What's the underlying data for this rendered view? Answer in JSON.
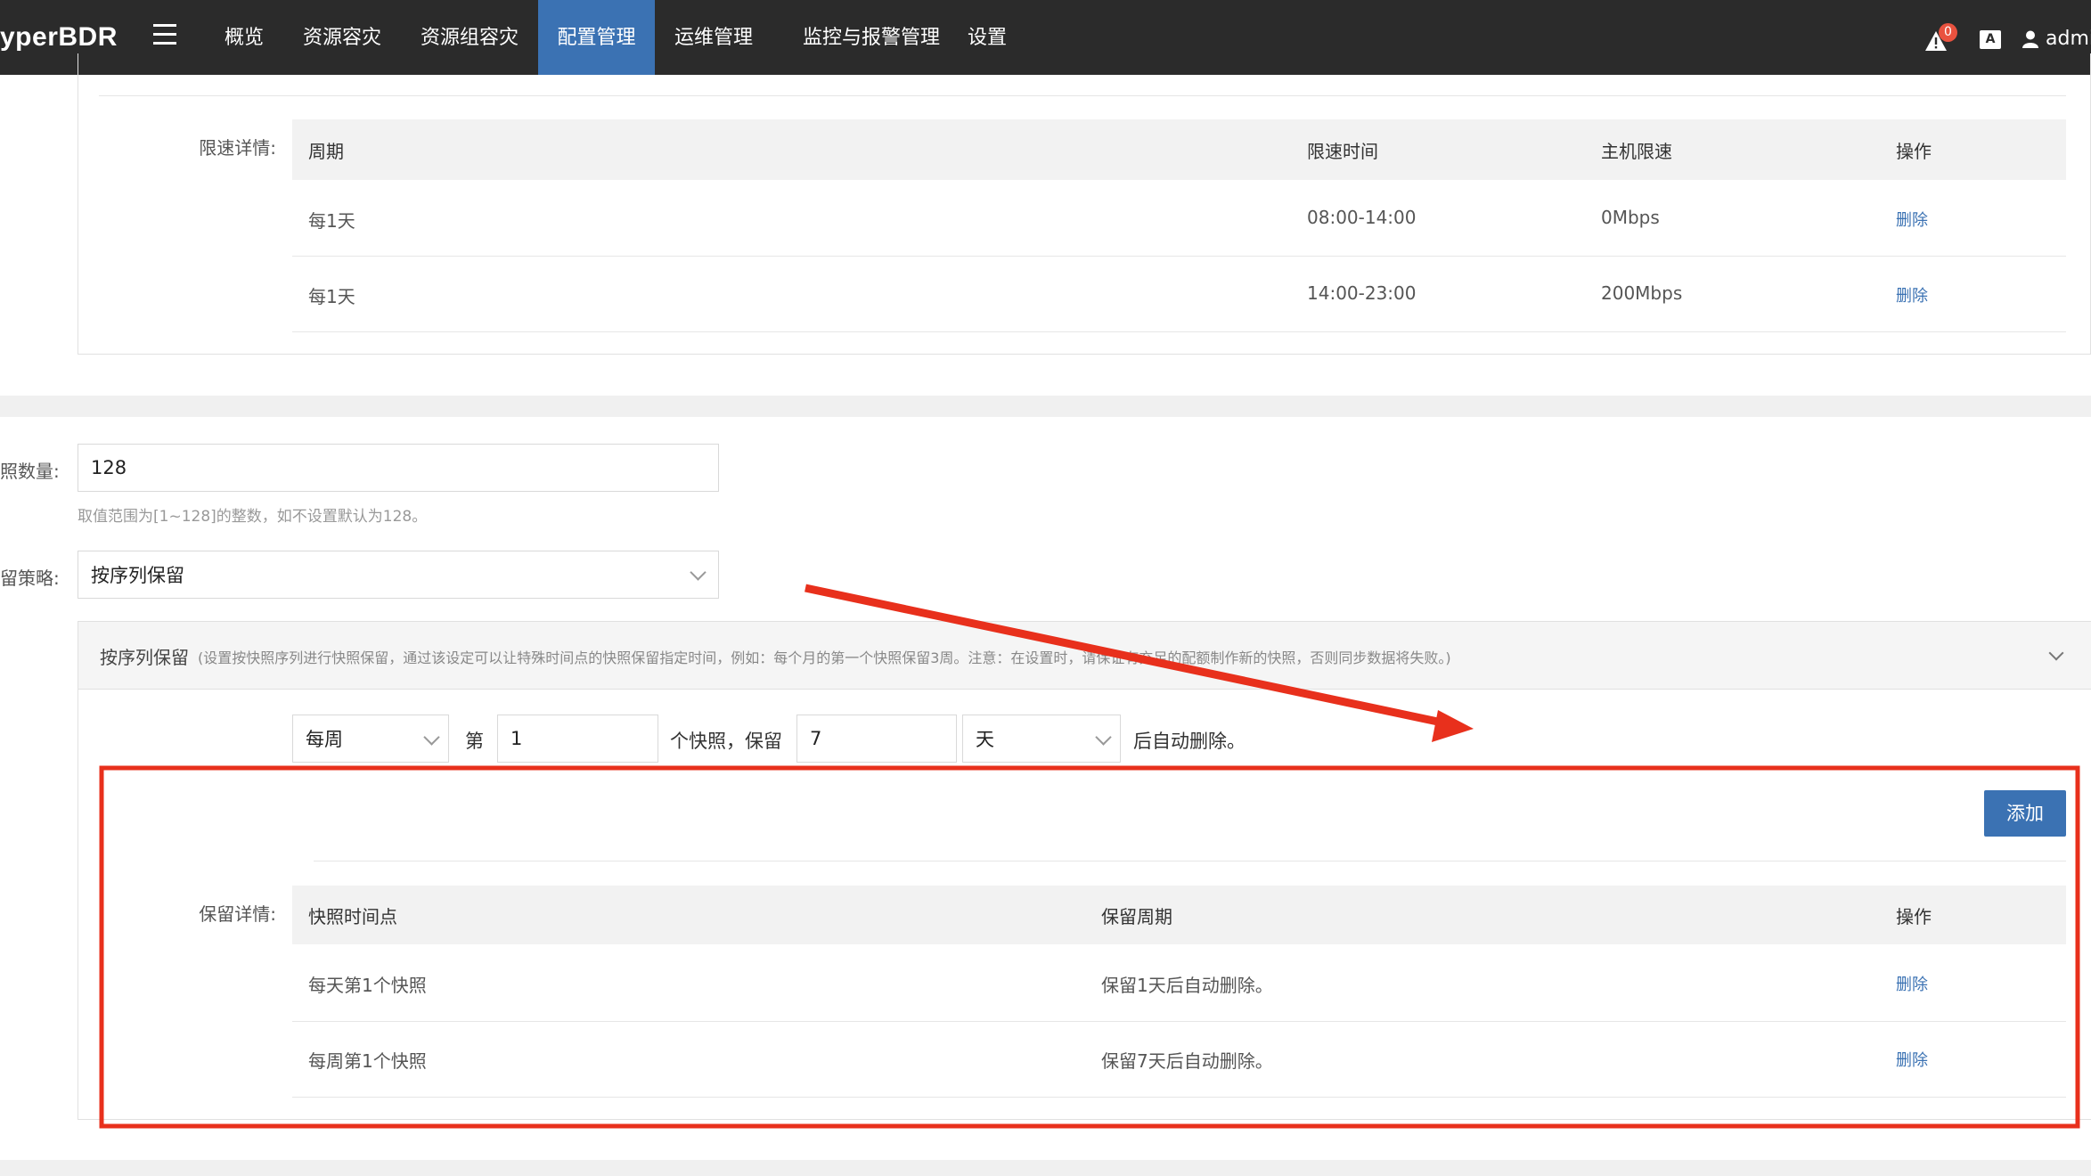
{
  "app": {
    "brand": "yperBDR"
  },
  "nav": [
    {
      "label": "概览",
      "active": false
    },
    {
      "label": "资源容灾",
      "active": false
    },
    {
      "label": "资源组容灾",
      "active": false
    },
    {
      "label": "配置管理",
      "active": true
    },
    {
      "label": "运维管理",
      "active": false
    },
    {
      "label": "监控与报警管理",
      "active": false
    },
    {
      "label": "设置",
      "active": false
    }
  ],
  "topbar": {
    "alert_count": "0",
    "lang_icon": "A",
    "user": "admin"
  },
  "speed_limit": {
    "label": "限速详情:",
    "columns": [
      "周期",
      "限速时间",
      "主机限速",
      "操作"
    ],
    "rows": [
      {
        "period": "每1天",
        "time": "08:00-14:00",
        "speed": "0Mbps",
        "action": "删除"
      },
      {
        "period": "每1天",
        "time": "14:00-23:00",
        "speed": "200Mbps",
        "action": "删除"
      }
    ]
  },
  "snapshot": {
    "count_label": "照数量:",
    "count_value": "128",
    "count_hint": "取值范围为[1~128]的整数，如不设置默认为128。",
    "policy_label": "留策略:",
    "policy_value": "按序列保留",
    "section_title": "按序列保留",
    "section_desc": "(设置按快照序列进行快照保留，通过该设定可以让特殊时间点的快照保留指定时间，例如：每个月的第一个快照保留3周。注意：在设置时，请保证有充足的配额制作新的快照，否则同步数据将失败。)",
    "rule": {
      "period": "每周",
      "text_nth": "第",
      "nth_value": "1",
      "text_keep": "个快照，保留",
      "keep_value": "7",
      "unit": "天",
      "text_after": "后自动删除。"
    },
    "add_button": "添加",
    "retention_label": "保留详情:",
    "columns": [
      "快照时间点",
      "保留周期",
      "操作"
    ],
    "rows": [
      {
        "point": "每天第1个快照",
        "period": "保留1天后自动删除。",
        "action": "删除"
      },
      {
        "point": "每周第1个快照",
        "period": "保留7天后自动删除。",
        "action": "删除"
      }
    ]
  },
  "annotation": {
    "box_color": "#e8301c",
    "arrow_color": "#e8301c"
  },
  "colors": {
    "topbar": "#2b2b2b",
    "accent": "#3b72b3",
    "alert": "#e9523f"
  }
}
